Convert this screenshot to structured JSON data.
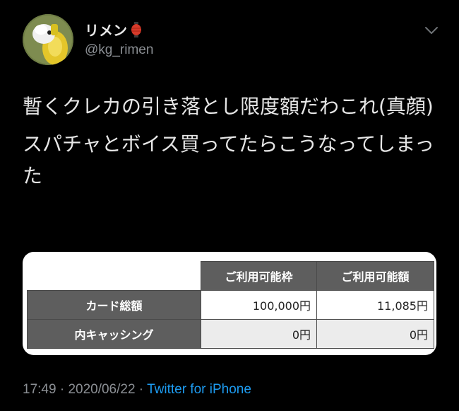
{
  "author": {
    "display_name": "リメン",
    "handle": "@kg_rimen",
    "name_emoji_icon": "red-lantern-icon"
  },
  "tweet": {
    "paragraph_1": "暫くクレカの引き落とし限度額だわこれ(真顔)",
    "paragraph_2": "スパチャとボイス買ってたらこうなってしまった"
  },
  "card_limit_table": {
    "column_headers": [
      "ご利用可能枠",
      "ご利用可能額"
    ],
    "rows": [
      {
        "label": "カード総額",
        "values": [
          "100,000円",
          "11,085円"
        ]
      },
      {
        "label": "内キャッシング",
        "values": [
          "0円",
          "0円"
        ]
      }
    ]
  },
  "meta": {
    "time": "17:49",
    "separator_1": " · ",
    "date": "2020/06/22",
    "separator_2": " · ",
    "source": "Twitter for iPhone"
  },
  "icons": {
    "avatar": "avatar-image",
    "more": "chevron-down-icon"
  },
  "colors": {
    "background": "#000000",
    "link": "#1d9bf0",
    "secondary_text": "#8b8f94",
    "table_header": "#5e5e5e"
  }
}
